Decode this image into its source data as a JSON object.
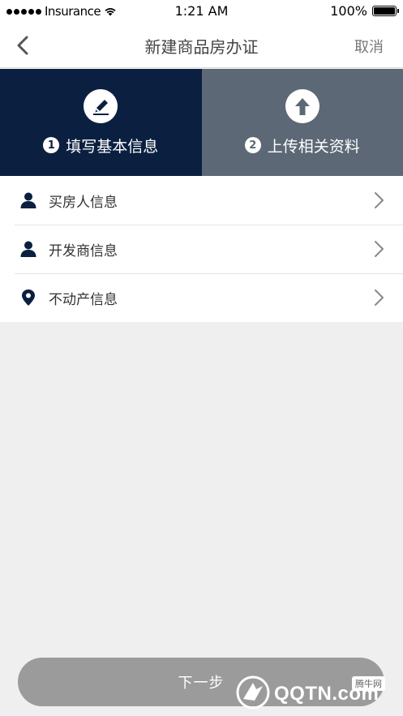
{
  "status_bar": {
    "carrier": "Insurance",
    "time": "1:21 AM",
    "battery": "100%"
  },
  "nav": {
    "title": "新建商品房办证",
    "cancel_label": "取消"
  },
  "steps": [
    {
      "number": "1",
      "label": "填写基本信息",
      "icon": "pen-icon",
      "active": true
    },
    {
      "number": "2",
      "label": "上传相关资料",
      "icon": "upload-arrow-icon",
      "active": false
    }
  ],
  "menu": {
    "items": [
      {
        "label": "买房人信息",
        "icon": "person-icon"
      },
      {
        "label": "开发商信息",
        "icon": "person-icon"
      },
      {
        "label": "不动产信息",
        "icon": "location-pin-icon"
      }
    ]
  },
  "footer": {
    "next_label": "下一步"
  },
  "watermark": {
    "brand": "QQTN.com",
    "tag": "腾牛网"
  },
  "colors": {
    "active_step_bg": "#0b2040",
    "inactive_step_bg": "#5c6875",
    "icon_color": "#0b2040",
    "button_bg": "#9b9b9b",
    "page_bg": "#efefef"
  }
}
